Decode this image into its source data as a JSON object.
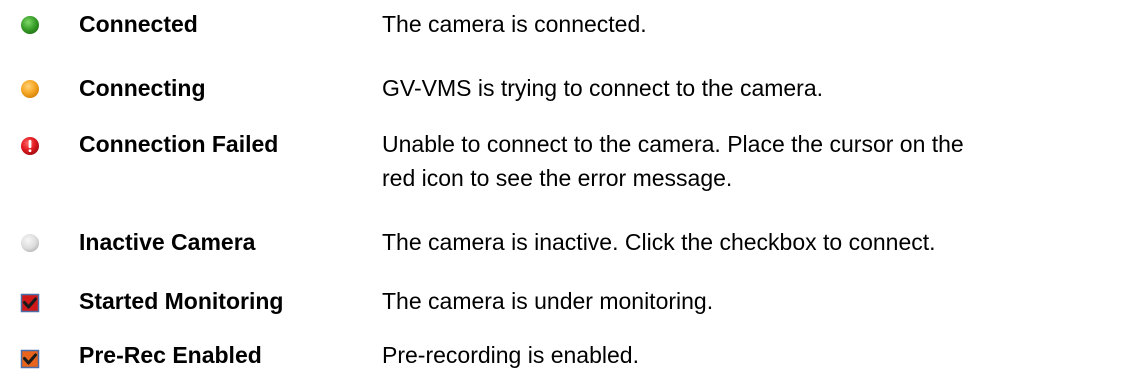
{
  "legend": {
    "items": [
      {
        "icon": "green-dot-icon",
        "color": "#3aa12a",
        "label": "Connected",
        "description_lines": [
          "The camera is connected."
        ]
      },
      {
        "icon": "orange-dot-icon",
        "color": "#f5a623",
        "label": "Connecting",
        "description_lines": [
          "GV-VMS is trying to connect to the camera."
        ]
      },
      {
        "icon": "red-error-icon",
        "color": "#e0191f",
        "label": "Connection Failed",
        "description_lines": [
          "Unable to connect to the camera. Place the cursor on the",
          "red icon to see the error message."
        ]
      },
      {
        "icon": "gray-dot-icon",
        "color": "#dcdcdc",
        "label": "Inactive Camera",
        "description_lines": [
          "The camera is inactive. Click the checkbox to connect."
        ]
      },
      {
        "icon": "checkbox-red-check-icon",
        "color": "#d01818",
        "label": "Started Monitoring",
        "description_lines": [
          "The camera is under monitoring."
        ]
      },
      {
        "icon": "checkbox-orange-check-icon",
        "color": "#e8641c",
        "label": "Pre-Rec Enabled",
        "description_lines": [
          "Pre-recording is enabled."
        ]
      }
    ]
  }
}
